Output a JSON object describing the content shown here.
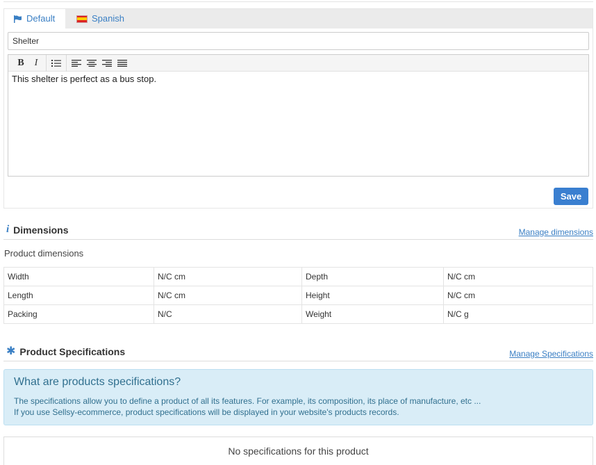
{
  "tabs": [
    {
      "label": "Default",
      "icon": "flag-icon",
      "active": true
    },
    {
      "label": "Spanish",
      "icon": "spanish-flag-icon",
      "active": false
    }
  ],
  "product_title": {
    "value": "Shelter"
  },
  "editor": {
    "toolbar": [
      "bold",
      "italic",
      "bulleted-list",
      "align-left",
      "align-center",
      "align-right",
      "justify"
    ],
    "toolbar_bold_label": "B",
    "toolbar_italic_label": "I",
    "content": "This shelter is perfect as a bus stop."
  },
  "save_label": "Save",
  "dimensions": {
    "title": "Dimensions",
    "manage_link": "Manage dimensions",
    "subtitle": "Product dimensions",
    "rows": [
      {
        "label1": "Width",
        "value1": "N/C cm",
        "label2": "Depth",
        "value2": "N/C cm"
      },
      {
        "label1": "Length",
        "value1": "N/C cm",
        "label2": "Height",
        "value2": "N/C cm"
      },
      {
        "label1": "Packing",
        "value1": "N/C",
        "label2": "Weight",
        "value2": "N/C g"
      }
    ]
  },
  "specifications": {
    "title": "Product Specifications",
    "manage_link": "Manage Specifications",
    "info_title": "What are products specifications?",
    "info_line1": "The specifications allow you to define a product of all its features. For example, its composition, its place of manufacture, etc ...",
    "info_line2": "If you use Sellsy-ecommerce, product specifications will be displayed in your website's products records.",
    "empty_message": "No specifications for this product"
  },
  "colors": {
    "accent": "#3a7fc4",
    "save_button": "#3a7fd0",
    "info_bg": "#d9edf7",
    "info_text": "#31708f"
  }
}
